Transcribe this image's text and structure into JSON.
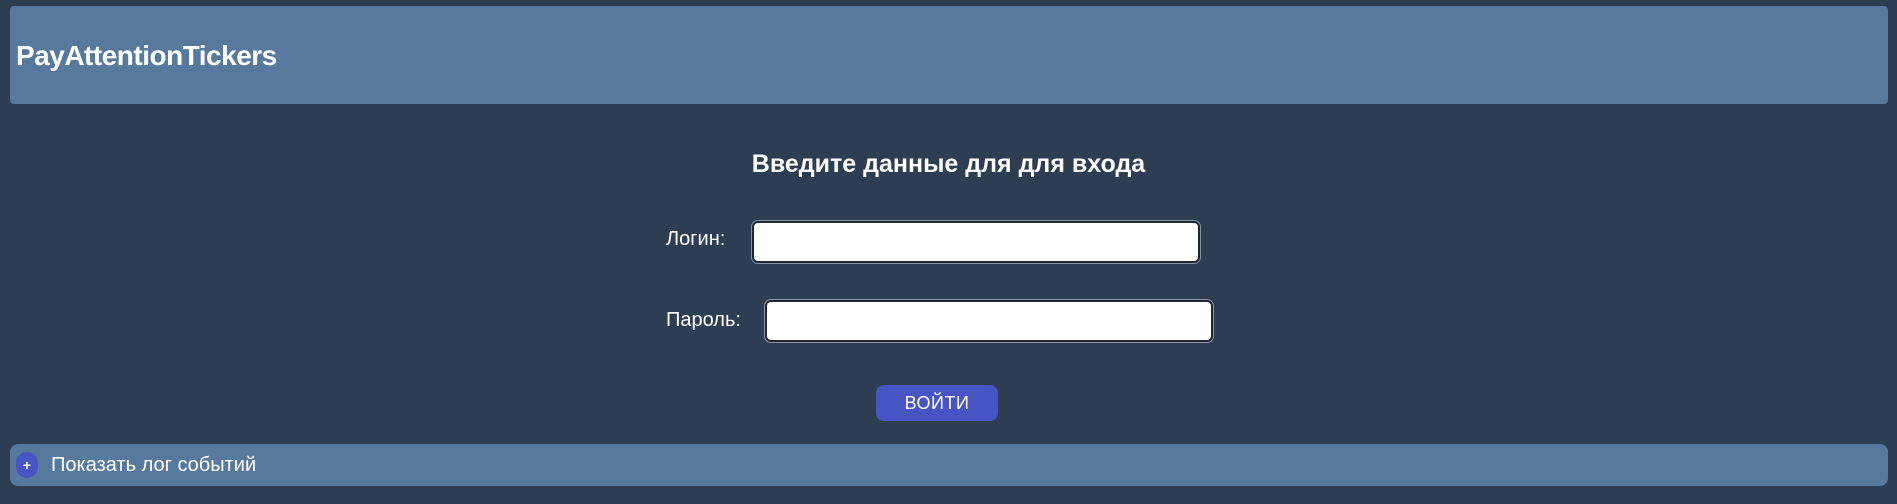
{
  "header": {
    "title": "PayAttentionTickers"
  },
  "login_form": {
    "heading": "Введите данные для для входа",
    "login_label": "Логин:",
    "login_value": "",
    "password_label": "Пароль:",
    "password_value": "",
    "submit_label": "ВОЙТИ"
  },
  "event_log": {
    "toggle_symbol": "+",
    "label": "Показать лог событий"
  },
  "colors": {
    "background": "#2e3e52",
    "panel": "#56799d",
    "accent": "#4754c4"
  }
}
